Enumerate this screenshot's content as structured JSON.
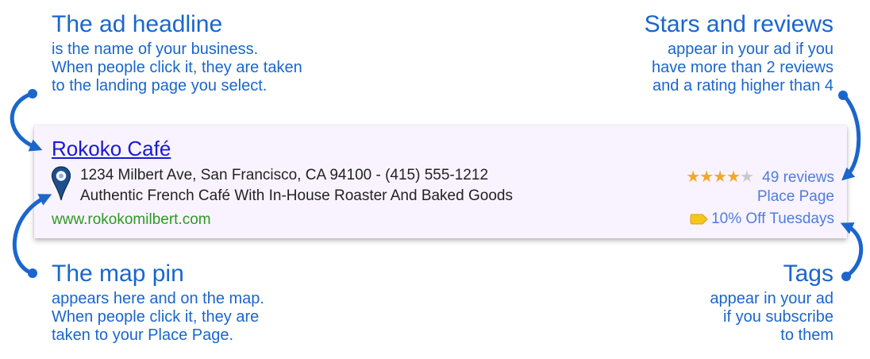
{
  "annotations": {
    "headline": {
      "heading": "The ad headline",
      "lines": [
        "is the name of your business.",
        "When people click it, they are taken",
        "to the landing page you select."
      ]
    },
    "stars": {
      "heading": "Stars and reviews",
      "lines": [
        "appear in your ad if you",
        "have more than 2 reviews",
        "and a rating higher than 4"
      ]
    },
    "map_pin": {
      "heading": "The map pin",
      "lines": [
        "appears here and on the map.",
        "When people click it, they are",
        "taken to your Place Page."
      ]
    },
    "tags": {
      "heading": "Tags",
      "lines": [
        "appear in your ad",
        "if you subscribe",
        "to them"
      ]
    }
  },
  "ad": {
    "title": "Rokoko Café",
    "address": "1234 Milbert Ave, San Francisco, CA 94100 - (415) 555-1212",
    "description": "Authentic French Café With In-House Roaster And Baked Goods",
    "url": "www.rokokomilbert.com",
    "rating": 4,
    "rating_max": 5,
    "reviews": "49 reviews",
    "place_page": "Place Page",
    "tag": "10% Off Tuesdays"
  },
  "icons": {
    "map_pin": "map-pin-icon",
    "star": "star-icon",
    "tag": "tag-icon"
  },
  "colors": {
    "annotation": "#1a66cc",
    "ad_background": "#f9f3ff",
    "title_link": "#1a1ad6",
    "url": "#2f9a23",
    "right_links": "#4d7de0",
    "star_on": "#f2a72a",
    "star_off": "#c9c9c9",
    "tag_fill": "#f6c61b",
    "pin_fill": "#1f4f8a"
  }
}
